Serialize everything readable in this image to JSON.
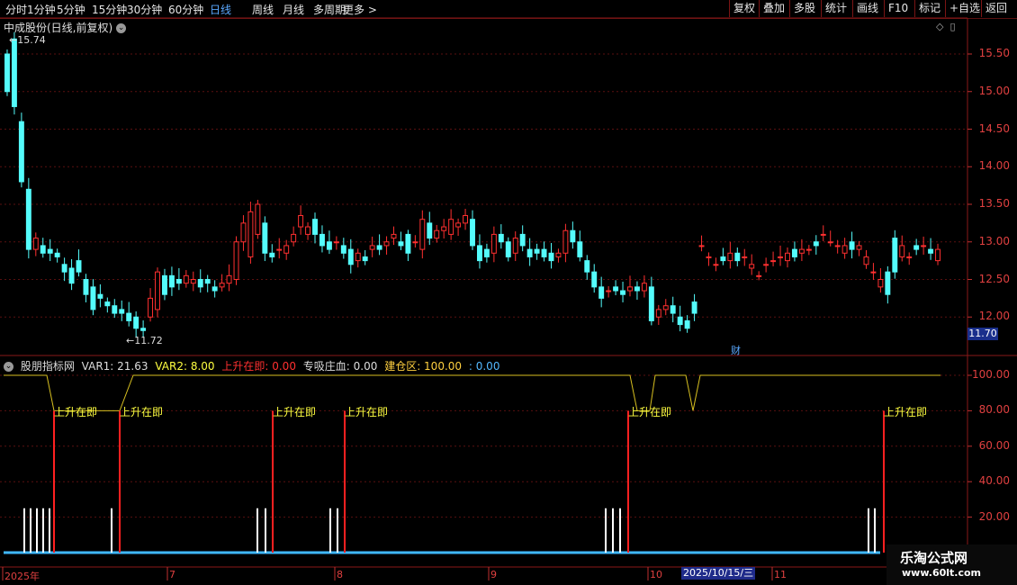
{
  "toolbar": {
    "periods": [
      "分时",
      "1分钟",
      "5分钟",
      "15分钟",
      "30分钟",
      "60分钟",
      "日线",
      "周线",
      "月线",
      "多周期",
      "更多 >"
    ],
    "active_period": "日线",
    "right_buttons": [
      "复权",
      "叠加",
      "多股",
      "统计",
      "画线",
      "F10",
      "标记",
      "+自选",
      "返回"
    ]
  },
  "chart": {
    "title": "中成股份(日线,前复权)",
    "high_label": "15.74",
    "low_label": "11.72",
    "current_price": "11.70",
    "finance_marker": "财",
    "price_axis": [
      "15.50",
      "15.00",
      "14.50",
      "14.00",
      "13.50",
      "13.00",
      "12.50",
      "12.00"
    ]
  },
  "indicator": {
    "name": "股朋指标网",
    "var1": "VAR1: 21.63",
    "var2": "VAR2: 8.00",
    "up": "上升在即: 0.00",
    "zhuan": "专吸庄血: 0.00",
    "jian": "建仓区: 100.00",
    "extra": ": 0.00",
    "signal_text": "上升在即",
    "axis": [
      "100.00",
      "80.00",
      "60.00",
      "40.00",
      "20.00"
    ]
  },
  "dates": {
    "labels": [
      "2025年",
      "7",
      "8",
      "9",
      "10",
      "11"
    ],
    "highlight": "2025/10/15/三"
  },
  "watermark": {
    "line1": "乐淘公式网",
    "line2": "www.60lt.com"
  },
  "colors": {
    "up": "#ff3030",
    "down": "#54fcfc",
    "axis": "#e04040",
    "yellow": "#ffff40",
    "grid": "#5a1010"
  },
  "chart_data": {
    "type": "candlestick",
    "opens": [
      15.5,
      15.7,
      14.6,
      13.7,
      12.9,
      12.95,
      12.9,
      12.85,
      12.7,
      12.65,
      12.75,
      12.5,
      12.4,
      12.3,
      12.2,
      12.15,
      12.1,
      12.05,
      12.0,
      11.85,
      12.0,
      12.1,
      12.55,
      12.55,
      12.5,
      12.45,
      12.45,
      12.5,
      12.5,
      12.4,
      12.4,
      12.45,
      12.5,
      13.0,
      12.8,
      13.1,
      13.25,
      12.85,
      12.9,
      12.85,
      13.0,
      13.2,
      13.1,
      13.3,
      13.1,
      13.0,
      13.0,
      12.95,
      12.9,
      12.75,
      12.8,
      12.9,
      12.95,
      12.95,
      13.05,
      13.0,
      13.1,
      13.0,
      12.9,
      13.25,
      13.05,
      13.15,
      13.1,
      13.2,
      13.25,
      13.3,
      12.95,
      12.9,
      12.85,
      13.1,
      13.0,
      12.85,
      13.1,
      12.9,
      12.9,
      12.9,
      12.85,
      12.8,
      12.85,
      13.15,
      13.0,
      12.75,
      12.6,
      12.4,
      12.35,
      12.4,
      12.35,
      12.35,
      12.4,
      12.35,
      12.4,
      12.0,
      12.1,
      12.15,
      12.0,
      11.95,
      12.2,
      12.95,
      12.8,
      12.7,
      12.8,
      12.75,
      12.85,
      12.8,
      12.65,
      12.55,
      12.7,
      12.75,
      12.8,
      12.75,
      12.9,
      12.85,
      12.9,
      13.0,
      13.1,
      13.0,
      12.95,
      12.85,
      13.0,
      12.9,
      12.7,
      12.6,
      12.4,
      12.6,
      13.05,
      12.8,
      12.8,
      12.95,
      12.95,
      12.9,
      12.75
    ],
    "closes": [
      15.0,
      14.8,
      13.8,
      12.9,
      13.05,
      12.85,
      12.85,
      12.8,
      12.6,
      12.45,
      12.6,
      12.3,
      12.1,
      12.25,
      12.15,
      12.05,
      12.05,
      11.95,
      11.85,
      11.82,
      12.25,
      12.6,
      12.3,
      12.4,
      12.45,
      12.55,
      12.5,
      12.4,
      12.45,
      12.35,
      12.45,
      12.55,
      13.0,
      13.25,
      13.4,
      13.5,
      12.85,
      12.8,
      12.9,
      12.95,
      13.1,
      13.35,
      13.2,
      13.1,
      12.95,
      12.9,
      13.0,
      12.85,
      12.7,
      12.85,
      12.75,
      12.95,
      12.9,
      13.0,
      13.1,
      12.95,
      12.85,
      13.0,
      13.3,
      13.05,
      13.15,
      13.2,
      13.3,
      13.25,
      13.35,
      12.95,
      12.75,
      12.8,
      13.1,
      13.0,
      12.8,
      13.05,
      12.95,
      12.8,
      12.85,
      12.8,
      12.75,
      12.85,
      13.15,
      13.0,
      12.8,
      12.6,
      12.4,
      12.25,
      12.35,
      12.35,
      12.3,
      12.4,
      12.35,
      12.45,
      11.95,
      12.1,
      12.15,
      12.05,
      11.9,
      11.85,
      12.05,
      12.95,
      12.8,
      12.7,
      12.75,
      12.85,
      12.75,
      12.8,
      12.7,
      12.55,
      12.7,
      12.75,
      12.8,
      12.85,
      12.8,
      12.9,
      12.9,
      12.95,
      13.1,
      13.0,
      12.95,
      12.95,
      12.9,
      12.95,
      12.8,
      12.6,
      12.5,
      12.3,
      12.6,
      12.95,
      12.8,
      12.9,
      12.95,
      12.85,
      12.9,
      12.75,
      12.65
    ]
  }
}
